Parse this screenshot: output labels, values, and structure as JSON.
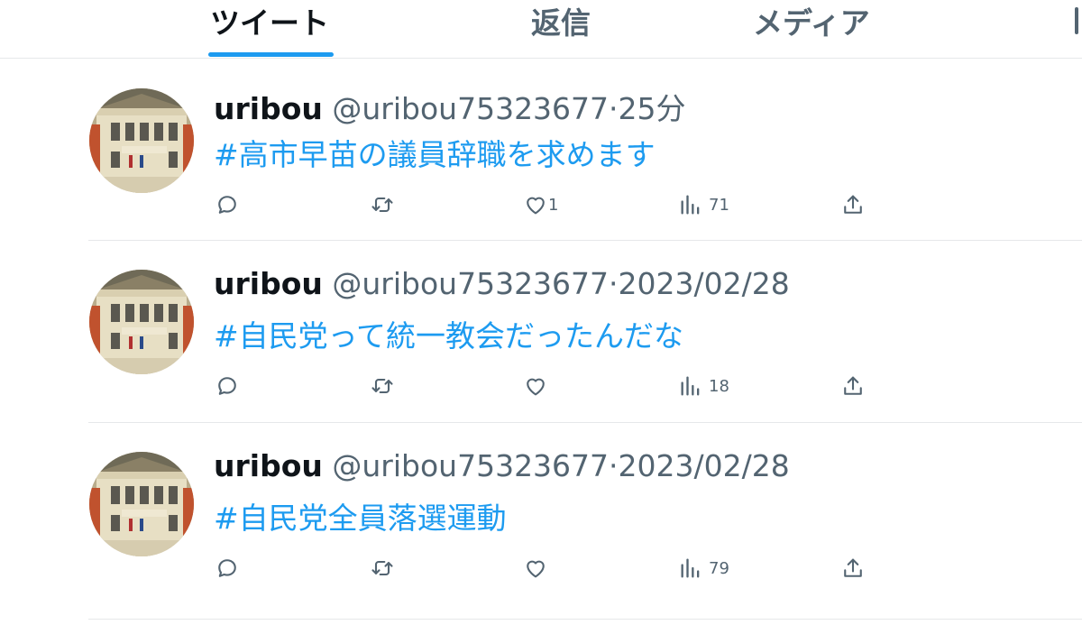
{
  "tabs": [
    {
      "label": "ツイート",
      "active": true
    },
    {
      "label": "返信",
      "active": false
    },
    {
      "label": "メディア",
      "active": false
    }
  ],
  "accent_color": "#1d9bf0",
  "tweets": [
    {
      "name": "uribou",
      "handle": "@uribou75323677",
      "separator": "·",
      "time": "25分",
      "text": "#高市早苗の議員辞職を求めます",
      "likes": "1",
      "views": "71",
      "icons": [
        "reply-icon",
        "retweet-icon",
        "like-icon",
        "views-icon",
        "share-icon"
      ]
    },
    {
      "name": "uribou",
      "handle": "@uribou75323677",
      "separator": "·",
      "time": "2023/02/28",
      "text": "#自民党って統一教会だったんだな",
      "likes": "",
      "views": "18",
      "icons": [
        "reply-icon",
        "retweet-icon",
        "like-icon",
        "views-icon",
        "share-icon"
      ]
    },
    {
      "name": "uribou",
      "handle": "@uribou75323677",
      "separator": "·",
      "time": "2023/02/28",
      "text": "#自民党全員落選運動",
      "likes": "",
      "views": "79",
      "icons": [
        "reply-icon",
        "retweet-icon",
        "like-icon",
        "views-icon",
        "share-icon"
      ]
    }
  ]
}
